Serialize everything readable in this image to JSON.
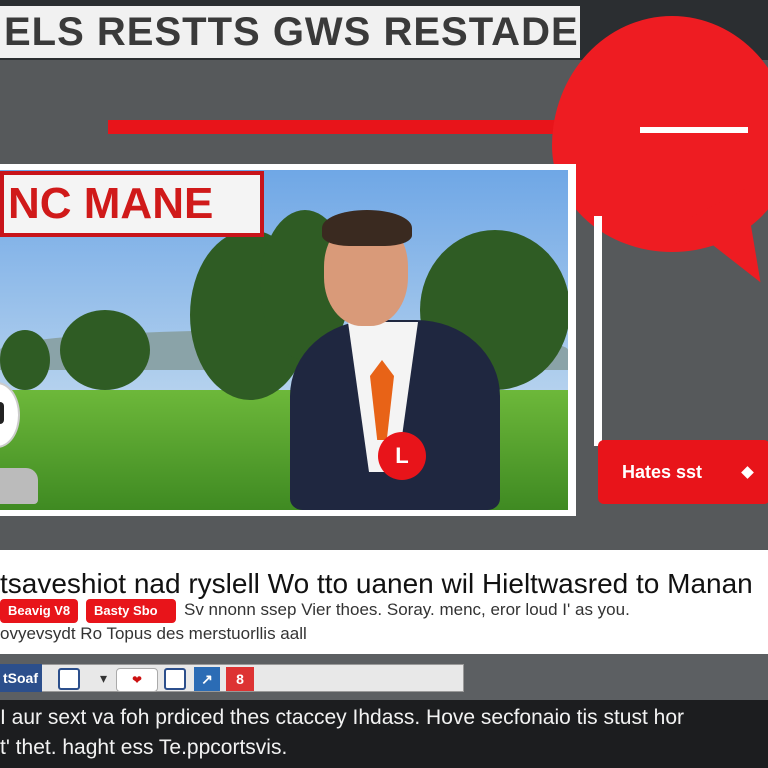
{
  "masthead": {
    "title": "ELS RESTTS GWS RESTADE"
  },
  "video": {
    "name_tag": "NC MANE",
    "play_icon": "play-icon",
    "play_glyph": "L"
  },
  "side": {
    "hashtag_button": "Hates sst"
  },
  "article": {
    "headline": "tsaveshiot nad ryslell Wo  tto uanen wil Hieltwasred to Manan",
    "tags": [
      "Beavig V8",
      "Basty Sbo"
    ],
    "subline1": "Sv nnonn ssep Vier thoes.  Soray. menc, eror loud I' as you.",
    "subline2": "ovyevsydt Ro Topus des merstuorllis aall"
  },
  "toolbar": {
    "label": "tSoaf",
    "pill_text": "❤",
    "twitter_glyph": "↗",
    "count": "8"
  },
  "caption": {
    "line1": "I aur sext va foh prdiced thes ctaccey Ihdass. Hove secfonaio tis stust hor",
    "line2": "t' thet. haght ess Te.ppcortsvis."
  },
  "colors": {
    "accent": "#e8141a",
    "panel": "#56595b",
    "toolbar_blue": "#2c4f8c"
  }
}
